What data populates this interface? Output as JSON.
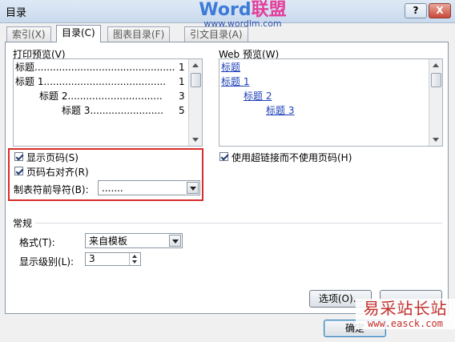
{
  "window": {
    "title": "目录",
    "help_btn": "?",
    "close_btn": "X"
  },
  "watermark_top": {
    "brand_a": "Word",
    "brand_b": "联盟",
    "url": "www.wordlm.com"
  },
  "tabs": [
    {
      "label": "索引(X)"
    },
    {
      "label": "目录(C)"
    },
    {
      "label": "图表目录(F)"
    },
    {
      "label": "引文目录(A)"
    }
  ],
  "print_preview": {
    "label": "打印预览(V)",
    "lines": [
      {
        "text": "标题",
        "dots": "..............................................",
        "page": "1"
      },
      {
        "text": "标题 1",
        "dots": "........................................",
        "page": "1"
      },
      {
        "text": "标题 2",
        "dots": "...............................",
        "page": "3"
      },
      {
        "text": "标题 3",
        "dots": "........................",
        "page": "5"
      }
    ]
  },
  "web_preview": {
    "label": "Web 预览(W)",
    "links": [
      "标题",
      "标题 1",
      "标题 2",
      "标题 3"
    ]
  },
  "options": {
    "show_page_numbers": "显示页码(S)",
    "right_align": "页码右对齐(R)",
    "tab_leader_label": "制表符前导符(B):",
    "tab_leader_value": ".......",
    "use_hyperlinks": "使用超链接而不使用页码(H)"
  },
  "general": {
    "header": "常规",
    "format_label": "格式(T):",
    "format_value": "来自模板",
    "levels_label": "显示级别(L):",
    "levels_value": "3"
  },
  "buttons": {
    "options": "选项(O)...",
    "ok": "确定"
  },
  "watermark_bottom": {
    "cn": "易采站长站",
    "url": "www.easck.com"
  },
  "colors": {
    "link": "#1b3fb7",
    "highlight": "#d92b2b"
  }
}
